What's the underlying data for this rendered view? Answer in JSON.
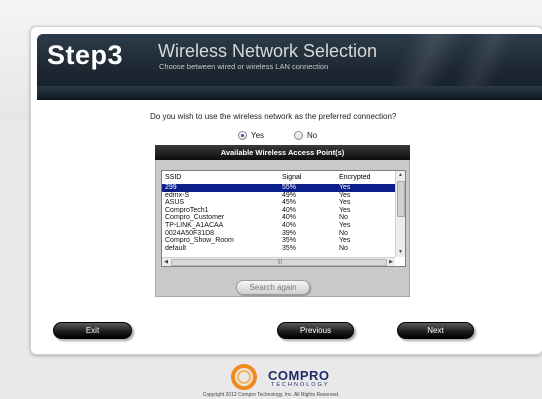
{
  "header": {
    "step": "Step3",
    "title": "Wireless Network Selection",
    "subtitle": "Choose between wired or wireless LAN connection"
  },
  "question": "Do you wish to use the wireless network as the preferred connection?",
  "options": {
    "yes_label": "Yes",
    "no_label": "No",
    "selected": "Yes"
  },
  "access_points": {
    "title": "Available Wireless Access Point(s)",
    "columns": [
      "SSID",
      "Signal",
      "Encrypted"
    ],
    "rows": [
      {
        "ssid": "299",
        "signal": "55%",
        "encrypted": "Yes"
      },
      {
        "ssid": "edmx-S",
        "signal": "49%",
        "encrypted": "Yes"
      },
      {
        "ssid": "ASUS",
        "signal": "45%",
        "encrypted": "Yes"
      },
      {
        "ssid": "ComproTech1",
        "signal": "40%",
        "encrypted": "Yes"
      },
      {
        "ssid": "Compro_Customer",
        "signal": "40%",
        "encrypted": "No"
      },
      {
        "ssid": "TP-LINK_A1ACAA",
        "signal": "40%",
        "encrypted": "Yes"
      },
      {
        "ssid": "0024A50F31D8",
        "signal": "39%",
        "encrypted": "No"
      },
      {
        "ssid": "Compro_Show_Room",
        "signal": "35%",
        "encrypted": "Yes"
      },
      {
        "ssid": "default",
        "signal": "35%",
        "encrypted": "No"
      }
    ],
    "selected_index": 0,
    "search_label": "Search again"
  },
  "nav": {
    "exit_label": "Exit",
    "previous_label": "Previous",
    "next_label": "Next"
  },
  "footer": {
    "brand": "COMPRO",
    "brand_sub": "TECHNOLOGY",
    "copyright": "Copyright 2012 Compro Technology, Inc. All Rights Reserved."
  },
  "colors": {
    "header_bg": "#1d2833",
    "selection": "#0b1f8a",
    "brand_blue": "#1d2c66",
    "logo_orange": "#f08a1c"
  },
  "icons": [
    "compro-logo-icon",
    "scroll-up-arrow-icon",
    "scroll-down-arrow-icon",
    "scroll-left-arrow-icon",
    "scroll-right-arrow-icon"
  ]
}
